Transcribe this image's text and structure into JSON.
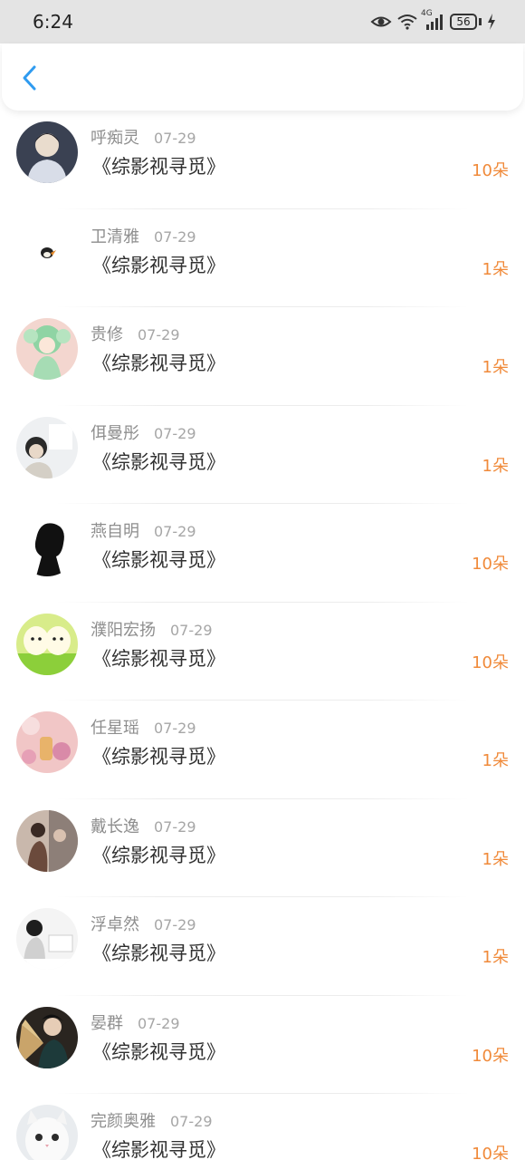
{
  "status_bar": {
    "time": "6:24",
    "network": "4G",
    "battery": "56",
    "icons": [
      "eye-icon",
      "wifi-icon",
      "signal-icon",
      "battery-icon",
      "charging-icon"
    ]
  },
  "header": {
    "back_icon": "chevron-left-icon"
  },
  "colors": {
    "accent": "#2f9bf0",
    "amount": "#f08a3a",
    "name": "#8e8e8e",
    "title": "#303030"
  },
  "records": [
    {
      "name": "呼痴灵",
      "date": "07-29",
      "work": "《综影视寻觅》",
      "amount": "10朵"
    },
    {
      "name": "卫清雅",
      "date": "07-29",
      "work": "《综影视寻觅》",
      "amount": "1朵"
    },
    {
      "name": "贵修",
      "date": "07-29",
      "work": "《综影视寻觅》",
      "amount": "1朵"
    },
    {
      "name": "佴曼彤",
      "date": "07-29",
      "work": "《综影视寻觅》",
      "amount": "1朵"
    },
    {
      "name": "燕自明",
      "date": "07-29",
      "work": "《综影视寻觅》",
      "amount": "10朵"
    },
    {
      "name": "濮阳宏扬",
      "date": "07-29",
      "work": "《综影视寻觅》",
      "amount": "10朵"
    },
    {
      "name": "任星瑶",
      "date": "07-29",
      "work": "《综影视寻觅》",
      "amount": "1朵"
    },
    {
      "name": "戴长逸",
      "date": "07-29",
      "work": "《综影视寻觅》",
      "amount": "1朵"
    },
    {
      "name": "浮卓然",
      "date": "07-29",
      "work": "《综影视寻觅》",
      "amount": "1朵"
    },
    {
      "name": "晏群",
      "date": "07-29",
      "work": "《综影视寻觅》",
      "amount": "10朵"
    },
    {
      "name": "完颜奥雅",
      "date": "07-29",
      "work": "《综影视寻觅》",
      "amount": "10朵"
    }
  ]
}
